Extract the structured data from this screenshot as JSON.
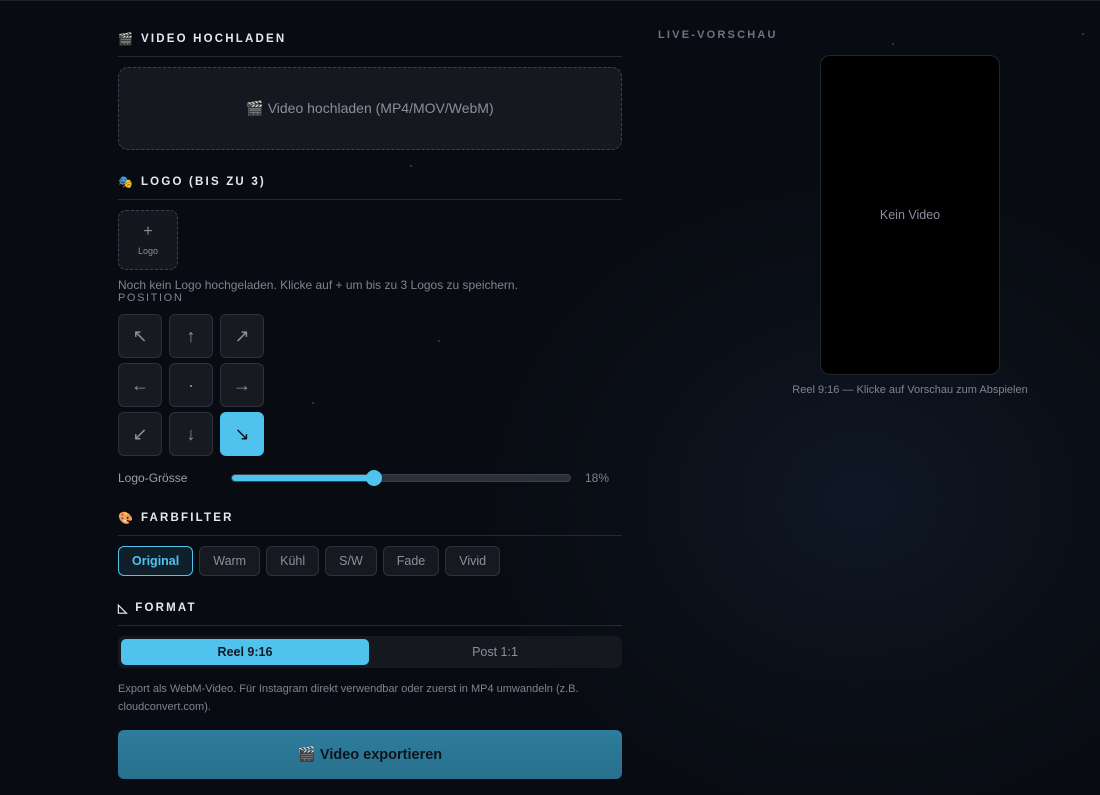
{
  "upload_section": {
    "icon": "clapper-icon",
    "icon_glyph": "🎬",
    "title": "VIDEO HOCHLADEN",
    "dropzone_label": "🎬 Video hochladen (MP4/MOV/WebM)"
  },
  "logo_section": {
    "icon": "masks-icon",
    "icon_glyph": "🎭",
    "title": "LOGO (BIS ZU 3)",
    "add_plus": "+",
    "add_label": "Logo",
    "empty_hint": "Noch kein Logo hochgeladen. Klicke auf + um bis zu 3 Logos zu speichern.",
    "position_label": "POSITION",
    "positions": [
      {
        "id": "top-left",
        "glyph": "↖"
      },
      {
        "id": "top-center",
        "glyph": "↑"
      },
      {
        "id": "top-right",
        "glyph": "↗"
      },
      {
        "id": "middle-left",
        "glyph": "←"
      },
      {
        "id": "center",
        "glyph": "·"
      },
      {
        "id": "middle-right",
        "glyph": "→"
      },
      {
        "id": "bottom-left",
        "glyph": "↙"
      },
      {
        "id": "bottom-center",
        "glyph": "↓"
      },
      {
        "id": "bottom-right",
        "glyph": "↘"
      }
    ],
    "active_position": "bottom-right",
    "size_label": "Logo-Grösse",
    "size_value": "18%",
    "size_fraction": 0.42
  },
  "filter_section": {
    "icon": "palette-icon",
    "icon_glyph": "🎨",
    "title": "FARBFILTER",
    "filters": [
      "Original",
      "Warm",
      "Kühl",
      "S/W",
      "Fade",
      "Vivid"
    ],
    "active": "Original"
  },
  "format_section": {
    "icon": "triangle-ruler-icon",
    "icon_glyph": "◺",
    "title": "FORMAT",
    "options": [
      "Reel 9:16",
      "Post 1:1"
    ],
    "active": "Reel 9:16",
    "export_note": "Export als WebM-Video. Für Instagram direkt verwendbar oder zuerst in MP4 umwandeln (z.B. cloudconvert.com).",
    "export_button": "🎬 Video exportieren"
  },
  "preview": {
    "title": "LIVE-VORSCHAU",
    "empty_text": "Kein Video",
    "caption": "Reel 9:16 — Klicke auf Vorschau zum Abspielen"
  },
  "colors": {
    "accent": "#4fc3ee",
    "background": "#0a0e16",
    "export_button": "#2e7c9c"
  }
}
